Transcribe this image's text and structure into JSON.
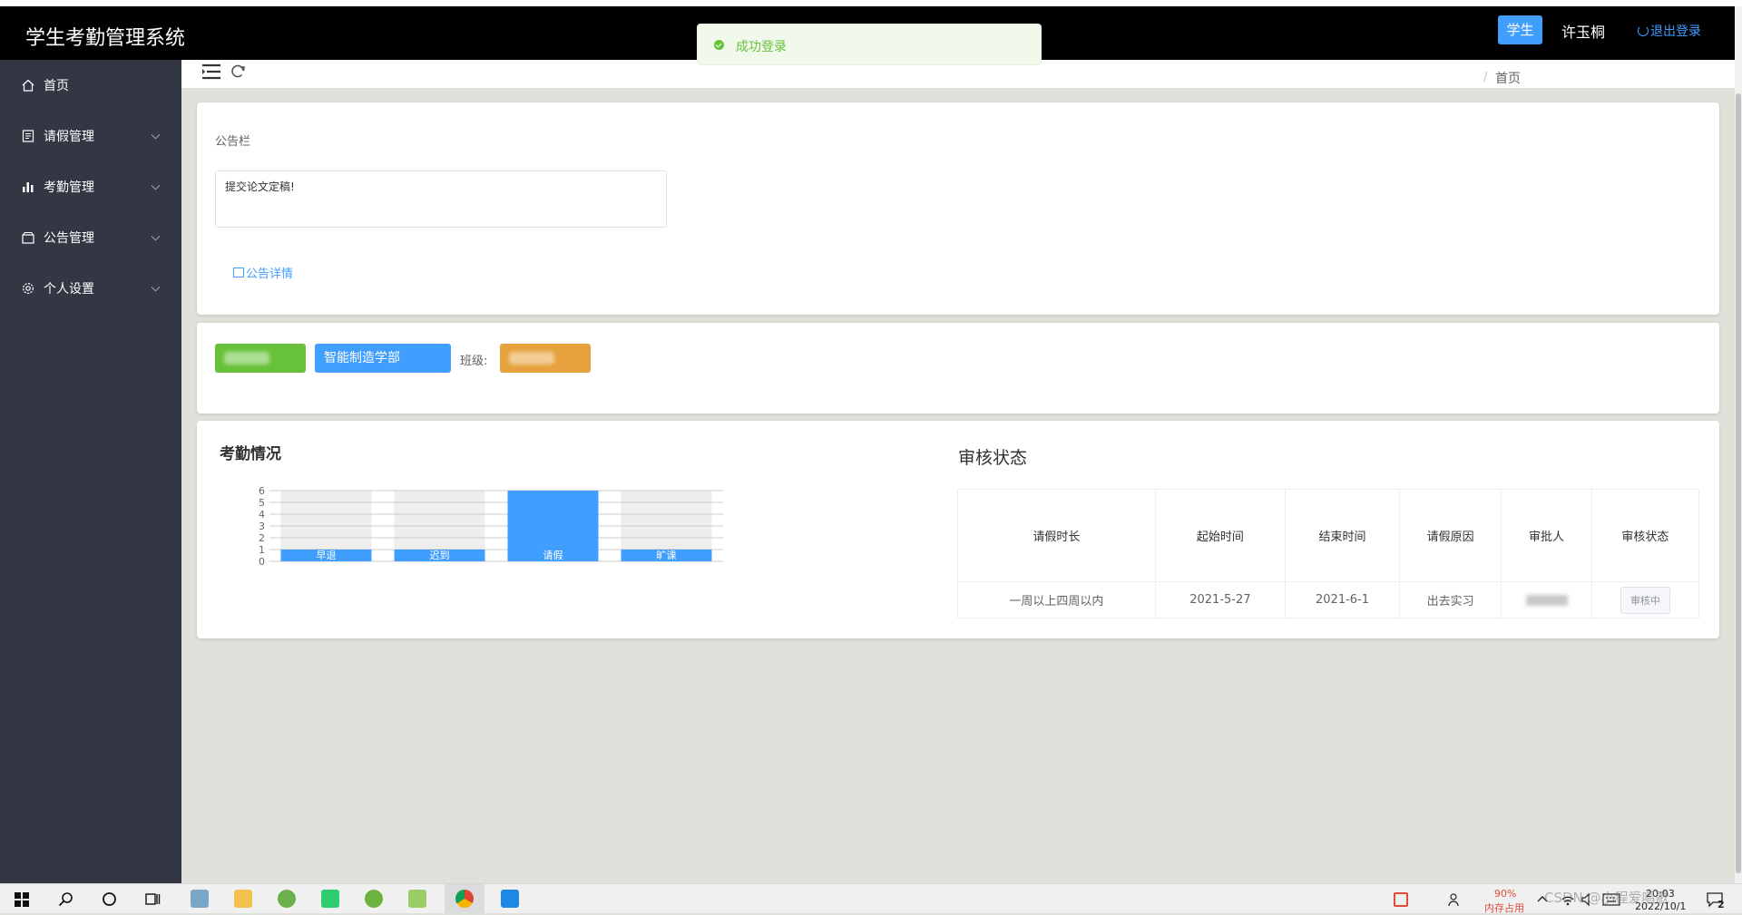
{
  "header": {
    "app_title": "学生考勤管理系统",
    "role": "学生",
    "user_name": "许玉桐",
    "logout_label": "退出登录"
  },
  "toast": {
    "message": "成功登录"
  },
  "sidebar": {
    "items": [
      {
        "label": "首页",
        "icon": "home-icon"
      },
      {
        "label": "请假管理",
        "icon": "document-icon"
      },
      {
        "label": "考勤管理",
        "icon": "bar-chart-icon"
      },
      {
        "label": "公告管理",
        "icon": "box-icon"
      },
      {
        "label": "个人设置",
        "icon": "gear-icon"
      }
    ]
  },
  "breadcrumb": {
    "separator": "/",
    "current": "首页"
  },
  "notice": {
    "title": "公告栏",
    "content": "提交论文定稿!",
    "detail_link": "公告详情"
  },
  "info": {
    "department": "智能制造学部",
    "class_label": "班级:"
  },
  "attendance": {
    "title": "考勤情况"
  },
  "audit": {
    "title": "审核状态",
    "headers": [
      "请假时长",
      "起始时间",
      "结束时间",
      "请假原因",
      "审批人",
      "审核状态"
    ],
    "rows": [
      {
        "duration": "一周以上四周以内",
        "start": "2021-5-27",
        "end": "2021-6-1",
        "reason": "出去实习",
        "status": "审核中"
      }
    ]
  },
  "chart_data": {
    "type": "bar",
    "categories": [
      "早退",
      "迟到",
      "请假",
      "旷课"
    ],
    "values": [
      1,
      1,
      6,
      1
    ],
    "ylim": [
      0,
      6
    ],
    "yticks": [
      0,
      1,
      2,
      3,
      4,
      5,
      6
    ],
    "grid": true,
    "colors": {
      "bar": "#409eff",
      "track": "#eeeeee"
    }
  },
  "taskbar": {
    "memory_percent": "90%",
    "memory_label": "内存占用",
    "clock_time": "20:03",
    "clock_date": "2022/10/1",
    "watermark": "CSDN @小程爱唱歌",
    "notification_count": "2"
  }
}
